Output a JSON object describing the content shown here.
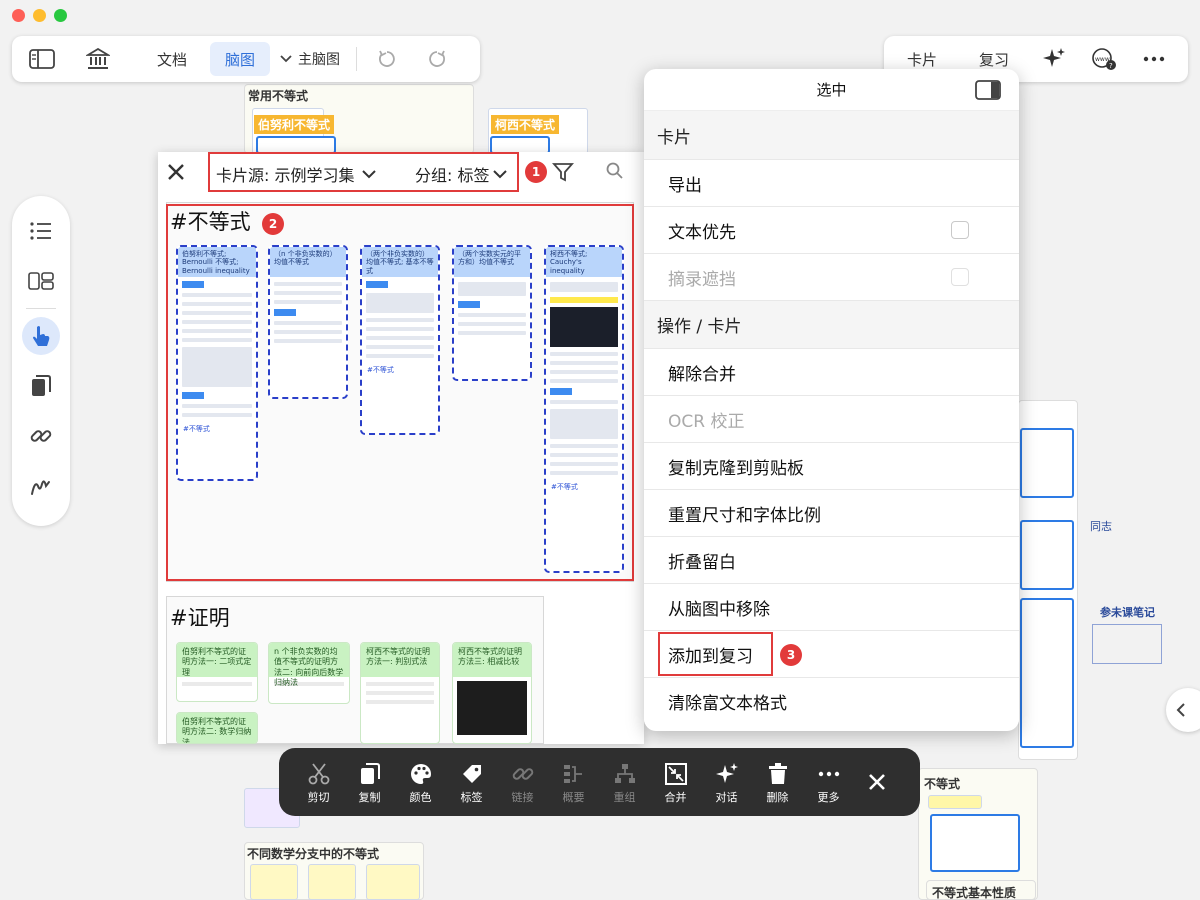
{
  "toolbar_left": {
    "doc_label": "文档",
    "mindmap_label": "脑图",
    "main_map_label": "主脑图"
  },
  "toolbar_right": {
    "cards_label": "卡片",
    "review_label": "复习"
  },
  "background": {
    "group1_title": "常用不等式",
    "tag1": "伯努利不等式",
    "tag2": "柯西不等式",
    "group2_title": "不同数学分支中的不等式",
    "group3_title": "不等式",
    "group4_title": "不等式基本性质",
    "hand_note1": "参未课笔记",
    "hand_note2": "同志"
  },
  "panel": {
    "source_label": "卡片源: 示例学习集",
    "group_label": "分组: 标签",
    "badge1": "1",
    "badge2": "2",
    "group_a_title": "#不等式",
    "group_b_title": "#证明",
    "cards_a": [
      {
        "title": "伯努利不等式; Bernoulli 不等式; Bernoulli inequality",
        "tag": "#不等式"
      },
      {
        "title": "（n 个非负实数的）均值不等式",
        "tag": ""
      },
      {
        "title": "（两个非负实数的）均值不等式; 基本不等式",
        "tag": "#不等式"
      },
      {
        "title": "（两个实数实元的平方和）均值不等式",
        "tag": ""
      },
      {
        "title": "柯西不等式; Cauchy's inequality",
        "tag": "#不等式"
      }
    ],
    "cards_b": [
      {
        "title": "伯努利不等式的证明方法一: 二项式定理"
      },
      {
        "title": "n 个非负实数的均值不等式的证明方法二: 向前向后数学归纳法"
      },
      {
        "title": "柯西不等式的证明方法一: 判别式法"
      },
      {
        "title": "柯西不等式的证明方法三: 相减比较"
      },
      {
        "title": "伯努利不等式的证明方法二: 数学归纳法"
      }
    ]
  },
  "menu": {
    "title": "选中",
    "section1": "卡片",
    "items1": [
      {
        "label": "导出",
        "disabled": false,
        "checkbox": false
      },
      {
        "label": "文本优先",
        "disabled": false,
        "checkbox": true
      },
      {
        "label": "摘录遮挡",
        "disabled": true,
        "checkbox": true
      }
    ],
    "section2": "操作 / 卡片",
    "items2": [
      {
        "label": "解除合并",
        "disabled": false
      },
      {
        "label": "OCR 校正",
        "disabled": true
      },
      {
        "label": "复制克隆到剪贴板",
        "disabled": false
      },
      {
        "label": "重置尺寸和字体比例",
        "disabled": false
      },
      {
        "label": "折叠留白",
        "disabled": false
      },
      {
        "label": "从脑图中移除",
        "disabled": false
      },
      {
        "label": "添加到复习",
        "disabled": false
      },
      {
        "label": "清除富文本格式",
        "disabled": false
      }
    ],
    "badge3": "3"
  },
  "actionbar": {
    "items": [
      {
        "label": "剪切",
        "icon": "scissors-icon",
        "disabled": false
      },
      {
        "label": "复制",
        "icon": "copy-icon",
        "disabled": false
      },
      {
        "label": "颜色",
        "icon": "palette-icon",
        "disabled": false
      },
      {
        "label": "标签",
        "icon": "tag-icon",
        "disabled": false
      },
      {
        "label": "链接",
        "icon": "link-icon",
        "disabled": true
      },
      {
        "label": "概要",
        "icon": "summary-icon",
        "disabled": true
      },
      {
        "label": "重组",
        "icon": "regroup-icon",
        "disabled": true
      },
      {
        "label": "合并",
        "icon": "merge-icon",
        "disabled": false
      },
      {
        "label": "对话",
        "icon": "sparkle-icon",
        "disabled": false
      },
      {
        "label": "删除",
        "icon": "trash-icon",
        "disabled": false
      },
      {
        "label": "更多",
        "icon": "more-icon",
        "disabled": false
      }
    ]
  },
  "colors": {
    "accent": "#2f6fd8",
    "highlight_red": "#e03b3b",
    "actionbar_bg": "#2f2f2f"
  }
}
